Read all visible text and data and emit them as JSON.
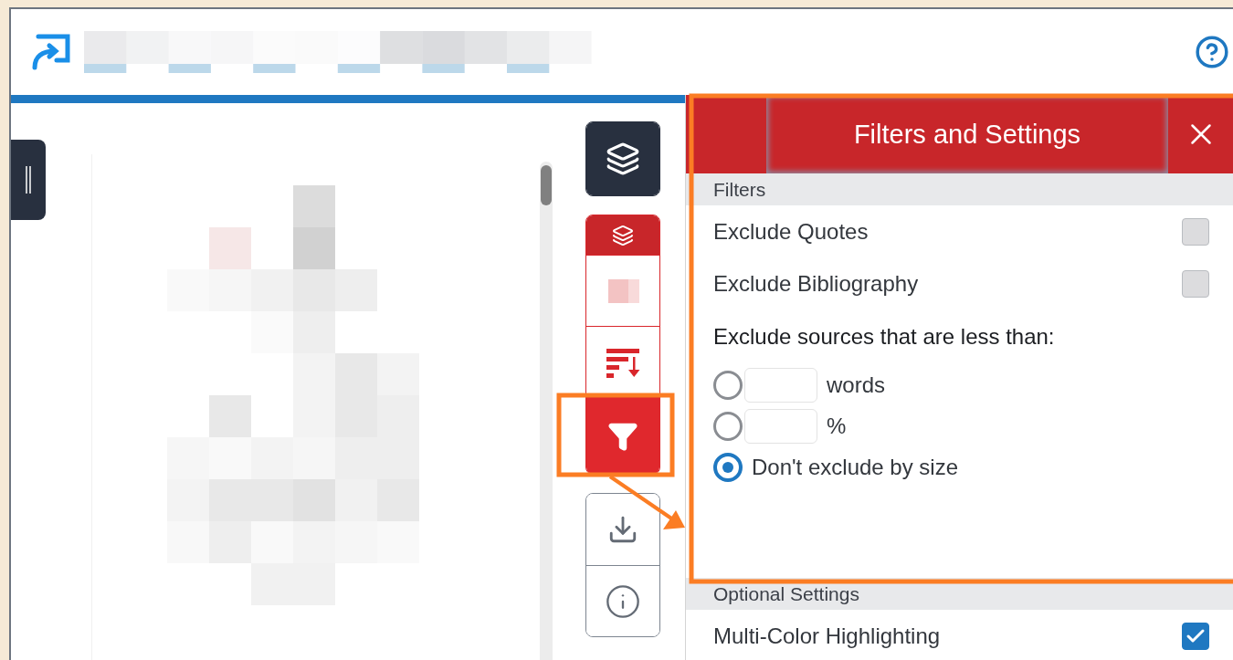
{
  "tool_rail": [
    {
      "kind": "dark",
      "items": [
        {
          "kind": "layers",
          "selected": false
        }
      ]
    },
    {
      "kind": "red",
      "items": [
        {
          "kind": "layers-header",
          "selected": false
        },
        {
          "kind": "blurred",
          "selected": false
        },
        {
          "kind": "sort",
          "selected": false
        },
        {
          "kind": "filter",
          "selected": true
        }
      ]
    },
    {
      "kind": "plain",
      "items": [
        {
          "kind": "download"
        },
        {
          "kind": "info"
        }
      ]
    }
  ],
  "panel": {
    "title": "Filters and Settings",
    "sections": [
      {
        "heading": "Filters",
        "rows": [
          {
            "kind": "checkbox",
            "label": "Exclude Quotes",
            "checked": false
          },
          {
            "kind": "checkbox",
            "label": "Exclude Bibliography",
            "checked": false
          },
          {
            "kind": "text",
            "label": "Exclude sources that are less than:"
          },
          {
            "kind": "radio-input",
            "label": "words",
            "selected": false
          },
          {
            "kind": "radio-input",
            "label": "%",
            "selected": false
          },
          {
            "kind": "radio",
            "label": "Don't exclude by size",
            "selected": true
          }
        ]
      },
      {
        "heading": "Optional Settings",
        "rows": [
          {
            "kind": "checkbox",
            "label": "Multi-Color Highlighting",
            "checked": true
          }
        ]
      }
    ]
  }
}
